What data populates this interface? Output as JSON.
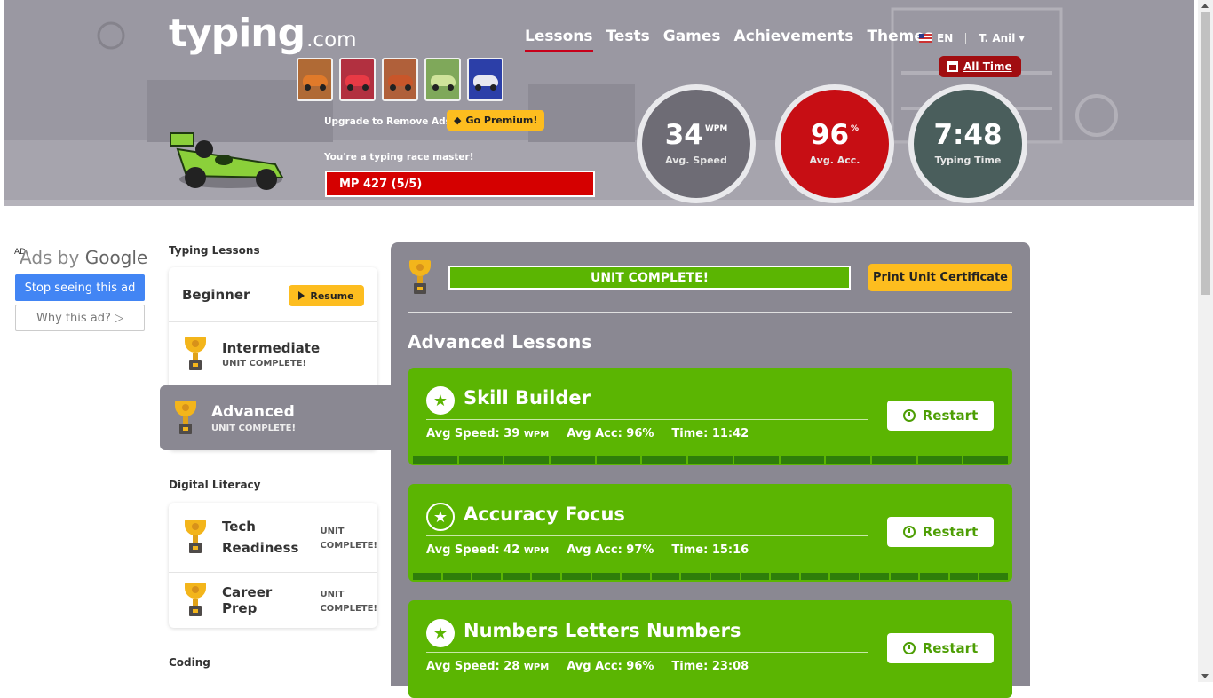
{
  "header": {
    "logo_main": "typing",
    "logo_suffix": ".com",
    "nav": [
      "Lessons",
      "Tests",
      "Games",
      "Achievements",
      "Themes"
    ],
    "language": "EN",
    "user": "T. Anil ▾",
    "all_time": "All Time",
    "upgrade_text": "Upgrade to Remove Ads:",
    "premium_label": "Go Premium!",
    "racer_text": "You're a typing race master!",
    "mp_bar": "MP 427 (5/5)",
    "car_colors": [
      "#e07a2a",
      "#c8262e",
      "#c8562a",
      "#9cc24a",
      "#2a3c9c"
    ],
    "stats": {
      "speed_value": "34",
      "speed_unit": "WPM",
      "speed_label": "Avg. Speed",
      "acc_value": "96",
      "acc_unit": "%",
      "acc_label": "Avg. Acc.",
      "time_value": "7:48",
      "time_label": "Typing Time"
    }
  },
  "ad": {
    "badge": "AD",
    "ads_by": "Ads by",
    "google": "Google",
    "stop": "Stop seeing this ad",
    "why": "Why this ad? ▷"
  },
  "sidebar": {
    "typing_heading": "Typing Lessons",
    "beginner": "Beginner",
    "resume": "Resume",
    "intermediate": "Intermediate",
    "intermediate_status": "UNIT COMPLETE!",
    "advanced": "Advanced",
    "advanced_status": "UNIT COMPLETE!",
    "digital_heading": "Digital Literacy",
    "tech_readiness": "Tech Readiness",
    "tech_status": "UNIT COMPLETE!",
    "career_prep": "Career Prep",
    "career_status": "UNIT COMPLETE!",
    "coding_heading": "Coding"
  },
  "main": {
    "unit_complete": "UNIT COMPLETE!",
    "print_cert": "Print Unit Certificate",
    "heading": "Advanced Lessons",
    "lessons": [
      {
        "title": "Skill Builder",
        "speed_label": "Avg Speed:",
        "speed": "39",
        "wpm": "WPM",
        "acc_label": "Avg Acc:",
        "acc": "96%",
        "time_label": "Time:",
        "time": "11:42",
        "restart": "Restart"
      },
      {
        "title": "Accuracy Focus",
        "speed_label": "Avg Speed:",
        "speed": "42",
        "wpm": "WPM",
        "acc_label": "Avg Acc:",
        "acc": "97%",
        "time_label": "Time:",
        "time": "15:16",
        "restart": "Restart"
      },
      {
        "title": "Numbers Letters Numbers",
        "speed_label": "Avg Speed:",
        "speed": "28",
        "wpm": "WPM",
        "acc_label": "Avg Acc:",
        "acc": "96%",
        "time_label": "Time:",
        "time": "23:08",
        "restart": "Restart"
      }
    ]
  }
}
